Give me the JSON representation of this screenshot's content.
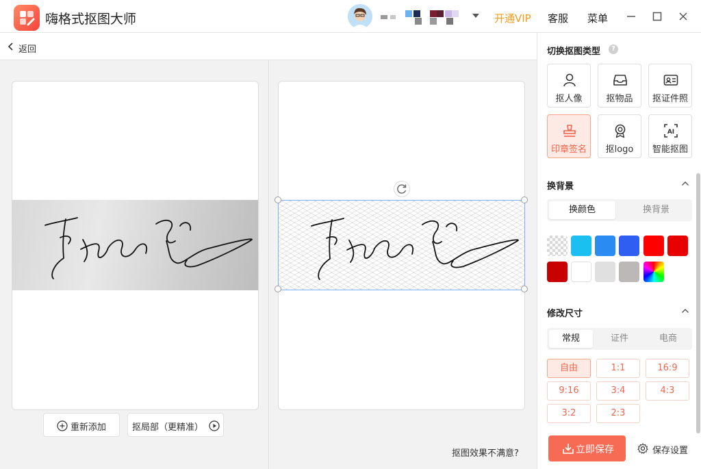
{
  "app": {
    "title": "嗨格式抠图大师",
    "vip_label": "开通VIP",
    "service_label": "客服",
    "menu_label": "菜单",
    "brand_color": "#f4543f",
    "accent_color": "#f76b55",
    "vip_color": "#f29b1b"
  },
  "toolbar": {
    "back_label": "返回"
  },
  "left_canvas": {
    "readd_label": "重新添加",
    "partial_label": "抠局部（更精准）"
  },
  "right_canvas": {
    "unsatisfied_label": "抠图效果不满意?"
  },
  "panel": {
    "type_section_title": "切换抠图类型",
    "types": [
      {
        "label": "抠人像",
        "icon": "person-icon",
        "active": false
      },
      {
        "label": "抠物品",
        "icon": "inbox-icon",
        "active": false
      },
      {
        "label": "抠证件照",
        "icon": "id-card-icon",
        "active": false
      },
      {
        "label": "印章签名",
        "icon": "stamp-icon",
        "active": true
      },
      {
        "label": "抠logo",
        "icon": "badge-icon",
        "active": false
      },
      {
        "label": "智能抠图",
        "icon": "ai-icon",
        "active": false
      }
    ],
    "background_section_title": "换背景",
    "background_tabs": [
      {
        "label": "换颜色",
        "active": true
      },
      {
        "label": "换背景",
        "active": false
      }
    ],
    "colors": [
      "transparent",
      "#1cc0f0",
      "#2a8cf0",
      "#2f5ef2",
      "#ff0000",
      "#e60000",
      "#c80000",
      "#ffffff",
      "#e0e0e0",
      "#bcb8b8",
      "rainbow"
    ],
    "size_section_title": "修改尺寸",
    "size_tabs": [
      {
        "label": "常规",
        "active": true
      },
      {
        "label": "证件",
        "active": false
      },
      {
        "label": "电商",
        "active": false
      }
    ],
    "ratios": [
      {
        "label": "自由",
        "active": true
      },
      {
        "label": "1:1",
        "active": false
      },
      {
        "label": "16:9",
        "active": false
      },
      {
        "label": "9:16",
        "active": false
      },
      {
        "label": "3:4",
        "active": false
      },
      {
        "label": "4:3",
        "active": false
      },
      {
        "label": "3:2",
        "active": false
      },
      {
        "label": "2:3",
        "active": false
      }
    ],
    "save_label": "立即保存",
    "save_settings_label": "保存设置"
  }
}
